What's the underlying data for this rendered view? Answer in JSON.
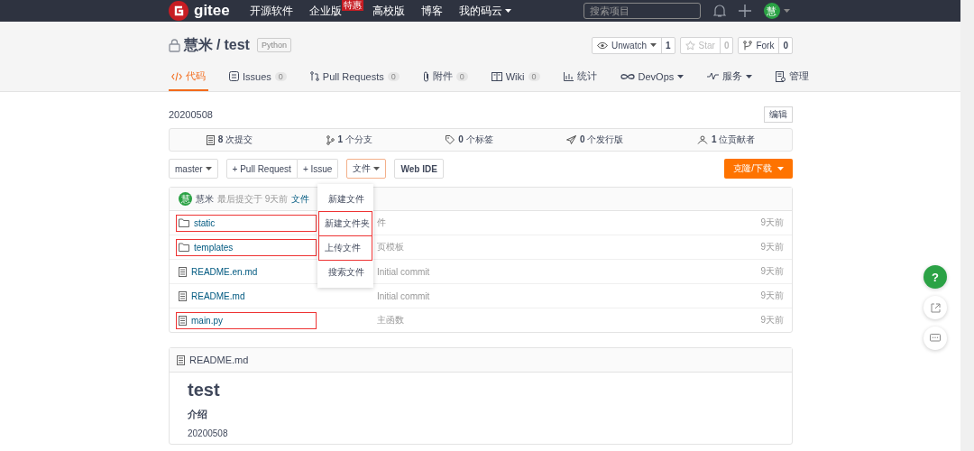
{
  "navbar": {
    "logo": "gitee",
    "menu": [
      {
        "label": "开源软件"
      },
      {
        "label": "企业版",
        "badge": "特惠"
      },
      {
        "label": "高校版"
      },
      {
        "label": "博客"
      },
      {
        "label": "我的码云",
        "dropdown": true
      }
    ],
    "search": {
      "placeholder": "搜索项目"
    },
    "avatar": "慧"
  },
  "repo": {
    "owner": "慧米",
    "separator": "/",
    "name": "test",
    "language": "Python",
    "actions": [
      {
        "label": "Unwatch",
        "count": "1",
        "dropdown": true,
        "disabled": false,
        "kind": "watch"
      },
      {
        "label": "Star",
        "count": "0",
        "disabled": true,
        "kind": "star"
      },
      {
        "label": "Fork",
        "count": "0",
        "disabled": false,
        "kind": "fork"
      }
    ]
  },
  "tabs": [
    {
      "label": "代码",
      "kind": "code",
      "selected": true
    },
    {
      "label": "Issues",
      "count": "0",
      "kind": "issues",
      "selected": false
    },
    {
      "label": "Pull Requests",
      "count": "0",
      "kind": "pr",
      "selected": false
    },
    {
      "label": "附件",
      "count": "0",
      "kind": "attach",
      "selected": false
    },
    {
      "label": "Wiki",
      "count": "0",
      "kind": "wiki",
      "selected": false
    },
    {
      "label": "统计",
      "kind": "stats",
      "selected": false
    },
    {
      "label": "DevOps",
      "kind": "devops",
      "dropdown": true,
      "selected": false
    },
    {
      "label": "服务",
      "kind": "service",
      "dropdown": true,
      "selected": false
    },
    {
      "label": "管理",
      "kind": "manage",
      "selected": false
    }
  ],
  "description": "20200508",
  "edit_button": "编辑",
  "stats": [
    {
      "text": "**8** 次提交",
      "kind": "commits"
    },
    {
      "text": "**1** 个分支",
      "kind": "branches"
    },
    {
      "text": "**0** 个标签",
      "kind": "tags"
    },
    {
      "text": "**0** 个发行版",
      "kind": "releases"
    },
    {
      "text": "**1** 位贡献者",
      "kind": "contributors"
    }
  ],
  "toolbar": {
    "branch": "master",
    "pull_request": "+ Pull Request",
    "issue": "+ Issue",
    "file_menu": "文件",
    "web_ide": "Web IDE",
    "clone": "克隆/下载"
  },
  "last_commit": {
    "avatar": "慧",
    "author": "慧米",
    "time": "最后提交于 9天前",
    "message": "文件"
  },
  "files": [
    {
      "name": "static",
      "kind": "folder",
      "message": "件",
      "time": "9天前",
      "highlighted": true
    },
    {
      "name": "templates",
      "kind": "folder",
      "message": "页模板",
      "time": "9天前",
      "highlighted": true
    },
    {
      "name": "README.en.md",
      "kind": "file",
      "message": "Initial commit",
      "time": "9天前",
      "highlighted": false
    },
    {
      "name": "README.md",
      "kind": "file",
      "message": "Initial commit",
      "time": "9天前",
      "highlighted": false
    },
    {
      "name": "main.py",
      "kind": "file",
      "message": "主函数",
      "time": "9天前",
      "highlighted": true
    }
  ],
  "file_dropdown": [
    {
      "label": "新建文件",
      "highlighted": false
    },
    {
      "label": "新建文件夹",
      "highlighted": true
    },
    {
      "label": "上传文件",
      "highlighted": true
    },
    {
      "label": "搜索文件",
      "highlighted": false
    }
  ],
  "readme": {
    "filename": "README.md",
    "title": "test",
    "heading": "介绍",
    "body": "20200508"
  },
  "float_buttons": [
    {
      "kind": "help",
      "label": "?"
    },
    {
      "kind": "share"
    },
    {
      "kind": "chat"
    }
  ]
}
